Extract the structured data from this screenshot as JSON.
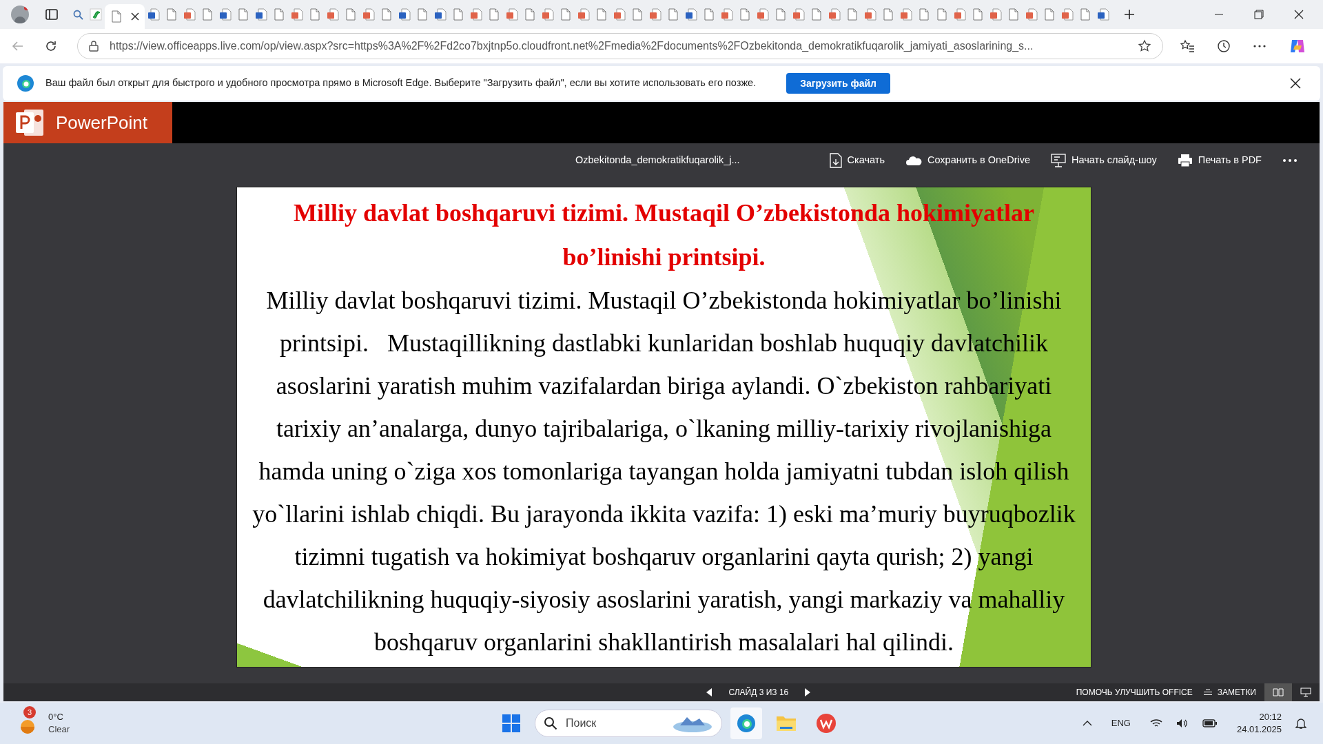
{
  "browser": {
    "tabs": [
      {
        "kind": "search",
        "selected": false
      },
      {
        "kind": "green",
        "selected": false
      },
      {
        "kind": "doc",
        "selected": true
      },
      {
        "kind": "word",
        "selected": false
      },
      {
        "kind": "doc",
        "selected": false
      },
      {
        "kind": "ppt",
        "selected": false
      },
      {
        "kind": "doc",
        "selected": false
      },
      {
        "kind": "word",
        "selected": false
      },
      {
        "kind": "doc",
        "selected": false
      },
      {
        "kind": "word",
        "selected": false
      },
      {
        "kind": "doc",
        "selected": false
      },
      {
        "kind": "ppt",
        "selected": false
      },
      {
        "kind": "doc",
        "selected": false
      },
      {
        "kind": "ppt",
        "selected": false
      },
      {
        "kind": "doc",
        "selected": false
      },
      {
        "kind": "ppt",
        "selected": false
      },
      {
        "kind": "doc",
        "selected": false
      },
      {
        "kind": "word",
        "selected": false
      },
      {
        "kind": "doc",
        "selected": false
      },
      {
        "kind": "word",
        "selected": false
      },
      {
        "kind": "doc",
        "selected": false
      },
      {
        "kind": "ppt",
        "selected": false
      },
      {
        "kind": "doc",
        "selected": false
      },
      {
        "kind": "ppt",
        "selected": false
      },
      {
        "kind": "doc",
        "selected": false
      },
      {
        "kind": "ppt",
        "selected": false
      },
      {
        "kind": "doc",
        "selected": false
      },
      {
        "kind": "ppt",
        "selected": false
      },
      {
        "kind": "doc",
        "selected": false
      },
      {
        "kind": "ppt",
        "selected": false
      },
      {
        "kind": "doc",
        "selected": false
      },
      {
        "kind": "ppt",
        "selected": false
      },
      {
        "kind": "doc",
        "selected": false
      },
      {
        "kind": "word",
        "selected": false
      },
      {
        "kind": "doc",
        "selected": false
      },
      {
        "kind": "ppt",
        "selected": false
      },
      {
        "kind": "doc",
        "selected": false
      },
      {
        "kind": "ppt",
        "selected": false
      },
      {
        "kind": "doc",
        "selected": false
      },
      {
        "kind": "ppt",
        "selected": false
      },
      {
        "kind": "doc",
        "selected": false
      },
      {
        "kind": "ppt",
        "selected": false
      },
      {
        "kind": "doc",
        "selected": false
      },
      {
        "kind": "ppt",
        "selected": false
      },
      {
        "kind": "doc",
        "selected": false
      },
      {
        "kind": "ppt",
        "selected": false
      },
      {
        "kind": "doc",
        "selected": false
      },
      {
        "kind": "doc",
        "selected": false
      },
      {
        "kind": "ppt",
        "selected": false
      },
      {
        "kind": "doc",
        "selected": false
      },
      {
        "kind": "ppt",
        "selected": false
      },
      {
        "kind": "doc",
        "selected": false
      },
      {
        "kind": "ppt",
        "selected": false
      },
      {
        "kind": "doc",
        "selected": false
      },
      {
        "kind": "ppt",
        "selected": false
      },
      {
        "kind": "doc",
        "selected": false
      },
      {
        "kind": "word",
        "selected": false
      }
    ],
    "url": "https://view.officeapps.live.com/op/view.aspx?src=https%3A%2F%2Fd2co7bxjtnp5o.cloudfront.net%2Fmedia%2Fdocuments%2FOzbekitonda_demokratikfuqarolik_jamiyati_asoslarining_s...",
    "infobar": {
      "message": "Ваш файл был открыт для быстрого и удобного просмотра прямо в Microsoft Edge. Выберите \"Загрузить файл\", если вы хотите использовать его позже.",
      "button": "Загрузить файл"
    }
  },
  "app": {
    "name": "PowerPoint",
    "filename": "Ozbekitonda_demokratikfuqarolik_j...",
    "actions": [
      {
        "kind": "download",
        "label": "Скачать"
      },
      {
        "kind": "onedrive",
        "label": "Сохранить в OneDrive"
      },
      {
        "kind": "slideshow",
        "label": "Начать слайд-шоу"
      },
      {
        "kind": "print",
        "label": "Печать в PDF"
      }
    ],
    "slide": {
      "title": "Milliy davlat boshqaruvi tizimi. Mustaqil O’zbekistonda hokimiyatlar bo’linishi printsipi.",
      "body": "Milliy davlat boshqaruvi tizimi. Mustaqil O’zbekistonda hokimiyatlar bo’linishi printsipi.   Mustaqillikning dastlabki kunlaridan boshlab huquqiy davlatchilik asoslarini yaratish muhim vazifalardan biriga aylandi. O`zbekiston rahbariyati tarixiy an’analarga, dunyo tajribalariga, o`lkaning milliy-tarixiy rivojlanishiga hamda uning o`ziga xos tomonlariga tayangan holda jamiyatni tubdan isloh qilish yo`llarini ishlab chiqdi. Bu jarayonda ikkita vazifa: 1) eski ma’muriy buyruqbozlik tizimni tugatish va hokimiyat boshqaruv organlarini qayta qurish; 2) yangi davlatchilikning huquqiy-siyosiy asoslarini yaratish, yangi markaziy va mahalliy boshqaruv organlarini shakllantirish masalalari hal qilindi."
    },
    "status": {
      "slide_counter": "СЛАЙД 3 ИЗ 16",
      "feedback": "ПОМОЧЬ УЛУЧШИТЬ OFFICE",
      "notes": "ЗАМЕТКИ"
    }
  },
  "taskbar": {
    "weather": {
      "badge": "3",
      "temp": "0°C",
      "condition": "Clear"
    },
    "search_placeholder": "Поиск",
    "language": "ENG",
    "time": "20:12",
    "date": "24.01.2025"
  }
}
